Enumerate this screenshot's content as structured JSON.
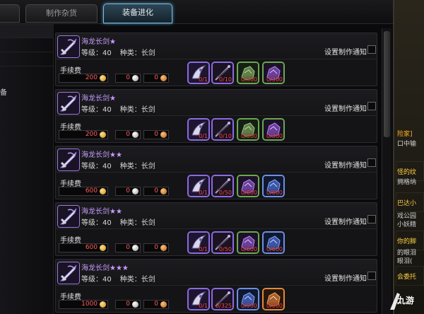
{
  "tabs": [
    {
      "label": ""
    },
    {
      "label": "制作杂货"
    },
    {
      "label": "装备进化"
    }
  ],
  "left_panel": {
    "text": "备"
  },
  "recipes": [
    {
      "name": "海龙长剑",
      "stars": "★",
      "level_label": "等级：40",
      "type_label": "种类：长剑",
      "notify_label": "设置制作通知",
      "fee_label": "手续费",
      "fee_gold": "200",
      "fee_silver": "0",
      "fee_copper": "0",
      "materials": [
        {
          "count": "0/1",
          "icon": "dragon-horn-icon",
          "frame": "purple"
        },
        {
          "count": "0/10",
          "icon": "dark-whip-icon",
          "frame": "purple"
        },
        {
          "count": "0/300",
          "icon": "green-ore-icon",
          "frame": "green"
        },
        {
          "count": "0/300",
          "icon": "purple-ore-icon",
          "frame": "green"
        }
      ]
    },
    {
      "name": "海龙长剑",
      "stars": "★",
      "level_label": "等级：40",
      "type_label": "种类：长剑",
      "notify_label": "设置制作通知",
      "fee_label": "手续费",
      "fee_gold": "200",
      "fee_silver": "0",
      "fee_copper": "0",
      "materials": [
        {
          "count": "0/1",
          "icon": "dragon-horn-icon",
          "frame": "purple"
        },
        {
          "count": "0/10",
          "icon": "dark-whip-icon",
          "frame": "purple"
        },
        {
          "count": "0/300",
          "icon": "green-ore-icon",
          "frame": "green"
        },
        {
          "count": "0/300",
          "icon": "purple-ore-icon",
          "frame": "green"
        }
      ]
    },
    {
      "name": "海龙长剑",
      "stars": "★★",
      "level_label": "等级：40",
      "type_label": "种类：长剑",
      "notify_label": "设置制作通知",
      "fee_label": "手续费",
      "fee_gold": "600",
      "fee_silver": "0",
      "fee_copper": "0",
      "materials": [
        {
          "count": "0/1",
          "icon": "dragon-horn-icon",
          "frame": "purple"
        },
        {
          "count": "0/50",
          "icon": "dark-whip-icon",
          "frame": "purple"
        },
        {
          "count": "0/600",
          "icon": "purple-ore-icon",
          "frame": "green"
        },
        {
          "count": "0/600",
          "icon": "blue-ore-icon",
          "frame": "blue"
        }
      ]
    },
    {
      "name": "海龙长剑",
      "stars": "★★",
      "level_label": "等级：40",
      "type_label": "种类：长剑",
      "notify_label": "设置制作通知",
      "fee_label": "手续费",
      "fee_gold": "600",
      "fee_silver": "0",
      "fee_copper": "0",
      "materials": [
        {
          "count": "0/1",
          "icon": "dragon-horn-icon",
          "frame": "purple"
        },
        {
          "count": "0/50",
          "icon": "dark-whip-icon",
          "frame": "purple"
        },
        {
          "count": "0/600",
          "icon": "purple-ore-icon",
          "frame": "green"
        },
        {
          "count": "0/600",
          "icon": "blue-ore-icon",
          "frame": "blue"
        }
      ]
    },
    {
      "name": "海龙长剑",
      "stars": "★★★",
      "level_label": "等级：40",
      "type_label": "种类：长剑",
      "notify_label": "设置制作通知",
      "fee_label": "手续费",
      "fee_gold": "1000",
      "fee_silver": "0",
      "fee_copper": "0",
      "materials": [
        {
          "count": "0/1",
          "icon": "dragon-horn-icon",
          "frame": "purple"
        },
        {
          "count": "0/325",
          "icon": "dark-whip-icon",
          "frame": "purple"
        },
        {
          "count": "0/900",
          "icon": "blue-ore-icon",
          "frame": "blue"
        },
        {
          "count": "0/900",
          "icon": "orange-ore-icon",
          "frame": "orange"
        }
      ]
    }
  ],
  "right_panel": {
    "lines": [
      {
        "text": "险家]",
        "color": "#ffb020"
      },
      {
        "text": "口中输",
        "color": "#d0d0d0"
      },
      {
        "text": "怪的纹",
        "color": "#ffd040"
      },
      {
        "text": "拥格纳",
        "color": "#d0d0d0"
      },
      {
        "text": "巴达小",
        "color": "#ffd040"
      },
      {
        "text": "戏公园",
        "color": "#d0d0d0"
      },
      {
        "text": "小妖精",
        "color": "#d0d0d0"
      },
      {
        "text": "你的脚",
        "color": "#ffd040"
      },
      {
        "text": "的眼泪",
        "color": "#d0d0d0"
      },
      {
        "text": "眼泪(",
        "color": "#d0d0d0"
      },
      {
        "text": "会委托",
        "color": "#ffd040"
      }
    ]
  },
  "watermark": {
    "text": "九游"
  }
}
